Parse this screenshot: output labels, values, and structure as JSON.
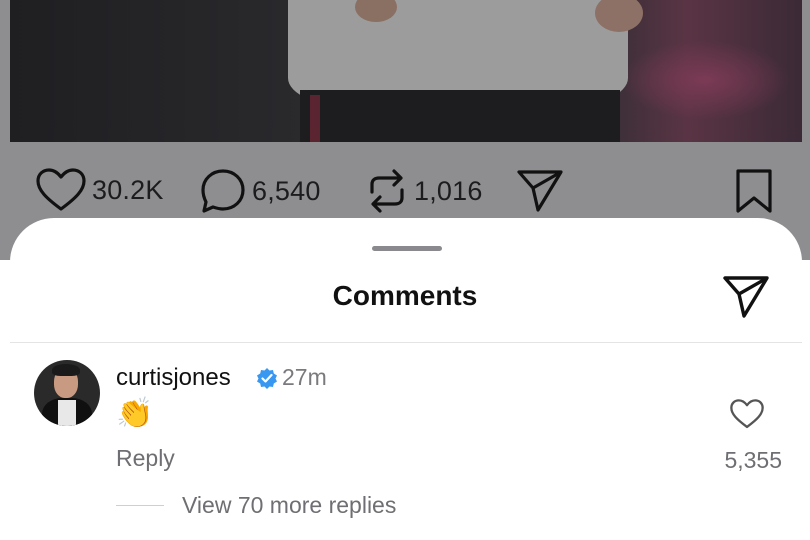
{
  "post": {
    "likes": "30.2K",
    "comments": "6,540",
    "reposts": "1,016",
    "icons": {
      "like": "heart-icon",
      "comment": "comment-bubble-icon",
      "repost": "repost-icon",
      "share": "paper-plane-icon",
      "save": "bookmark-icon"
    }
  },
  "sheet": {
    "title": "Comments",
    "share_icon": "paper-plane-icon"
  },
  "comment": {
    "username": "curtisjones",
    "verified": true,
    "time": "27m",
    "text": "👏",
    "reply_label": "Reply",
    "like_count": "5,355",
    "view_replies": "View 70 more replies"
  },
  "colors": {
    "dim_overlay": "#8e8e91",
    "verified_blue": "#3897f0",
    "secondary_text": "#6f6f73"
  }
}
